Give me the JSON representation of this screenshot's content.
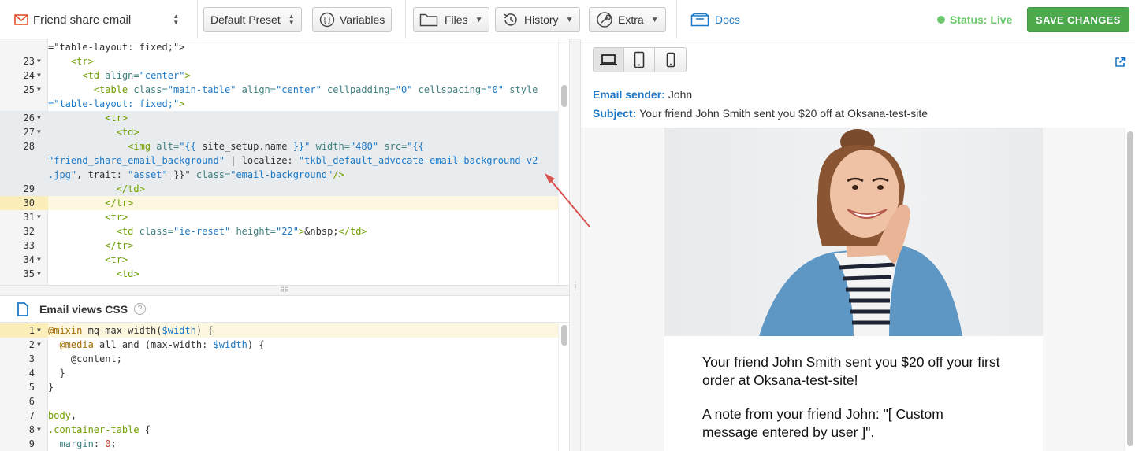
{
  "topbar": {
    "template_name": "Friend share email",
    "preset": "Default Preset",
    "variables": "Variables",
    "files": "Files",
    "history": "History",
    "extra": "Extra",
    "docs": "Docs",
    "status": "Status: Live",
    "save": "SAVE CHANGES"
  },
  "html_editor": {
    "lines": [
      {
        "num": "",
        "fold": false,
        "tokens": [
          [
            "p",
            "=\"table-layout: fixed;\">"
          ]
        ]
      },
      {
        "num": "23",
        "fold": true,
        "tokens": [
          [
            "p",
            "    "
          ],
          [
            "t",
            "<tr>"
          ]
        ]
      },
      {
        "num": "24",
        "fold": true,
        "tokens": [
          [
            "p",
            "      "
          ],
          [
            "t",
            "<td "
          ],
          [
            "a",
            "align="
          ],
          [
            "s",
            "\"center\""
          ],
          [
            "t",
            ">"
          ]
        ]
      },
      {
        "num": "25",
        "fold": true,
        "tokens": [
          [
            "p",
            "        "
          ],
          [
            "t",
            "<table "
          ],
          [
            "a",
            "class="
          ],
          [
            "s",
            "\"main-table\" "
          ],
          [
            "a",
            "align="
          ],
          [
            "s",
            "\"center\" "
          ],
          [
            "a",
            "cellpadding="
          ],
          [
            "s",
            "\"0\" "
          ],
          [
            "a",
            "cellspacing="
          ],
          [
            "s",
            "\"0\" "
          ],
          [
            "a",
            "style"
          ]
        ]
      },
      {
        "num": "",
        "fold": false,
        "tokens": [
          [
            "s",
            "=\"table-layout: fixed;\""
          ],
          [
            "t",
            ">"
          ]
        ]
      },
      {
        "num": "26",
        "fold": true,
        "hl": true,
        "tokens": [
          [
            "p",
            "          "
          ],
          [
            "t",
            "<tr>"
          ]
        ]
      },
      {
        "num": "27",
        "fold": true,
        "hl": true,
        "tokens": [
          [
            "p",
            "            "
          ],
          [
            "t",
            "<td>"
          ]
        ]
      },
      {
        "num": "28",
        "fold": false,
        "hl": true,
        "tokens": [
          [
            "p",
            "              "
          ],
          [
            "t",
            "<img "
          ],
          [
            "a",
            "alt="
          ],
          [
            "s",
            "\"{{ "
          ],
          [
            "p",
            "site_setup.name "
          ],
          [
            "s",
            "}}\" "
          ],
          [
            "a",
            "width="
          ],
          [
            "s",
            "\"480\" "
          ],
          [
            "a",
            "src="
          ],
          [
            "s",
            "\"{{"
          ]
        ]
      },
      {
        "num": "",
        "fold": false,
        "hl": true,
        "tokens": [
          [
            "s",
            "\"friend_share_email_background\" "
          ],
          [
            "p",
            "| localize: "
          ],
          [
            "s",
            "\"tkbl_default_advocate-email-background-v2"
          ]
        ]
      },
      {
        "num": "",
        "fold": false,
        "hl": true,
        "tokens": [
          [
            "s",
            ".jpg\""
          ],
          [
            "p",
            ", trait: "
          ],
          [
            "s",
            "\"asset\" "
          ],
          [
            "p",
            "}}\" "
          ],
          [
            "a",
            "class="
          ],
          [
            "s",
            "\"email-background\""
          ],
          [
            "t",
            "/>"
          ]
        ]
      },
      {
        "num": "29",
        "fold": false,
        "hl": true,
        "tokens": [
          [
            "p",
            "            "
          ],
          [
            "t",
            "</td>"
          ]
        ]
      },
      {
        "num": "30",
        "fold": false,
        "cur": true,
        "tokens": [
          [
            "p",
            "          "
          ],
          [
            "t",
            "</tr>"
          ]
        ]
      },
      {
        "num": "31",
        "fold": true,
        "tokens": [
          [
            "p",
            "          "
          ],
          [
            "t",
            "<tr>"
          ]
        ]
      },
      {
        "num": "32",
        "fold": false,
        "tokens": [
          [
            "p",
            "            "
          ],
          [
            "t",
            "<td "
          ],
          [
            "a",
            "class="
          ],
          [
            "s",
            "\"ie-reset\" "
          ],
          [
            "a",
            "height="
          ],
          [
            "s",
            "\"22\""
          ],
          [
            "t",
            ">"
          ],
          [
            "p",
            "&nbsp;"
          ],
          [
            "t",
            "</td>"
          ]
        ]
      },
      {
        "num": "33",
        "fold": false,
        "tokens": [
          [
            "p",
            "          "
          ],
          [
            "t",
            "</tr>"
          ]
        ]
      },
      {
        "num": "34",
        "fold": true,
        "tokens": [
          [
            "p",
            "          "
          ],
          [
            "t",
            "<tr>"
          ]
        ]
      },
      {
        "num": "35",
        "fold": true,
        "tokens": [
          [
            "p",
            "            "
          ],
          [
            "t",
            "<td>"
          ]
        ]
      }
    ]
  },
  "css_editor": {
    "title": "Email views CSS",
    "help": "?",
    "lines": [
      {
        "num": "1",
        "fold": true,
        "cur": true,
        "tokens": [
          [
            "k",
            "@mixin "
          ],
          [
            "p",
            "mq-max-width("
          ],
          [
            "v",
            "$width"
          ],
          [
            "p",
            ") {"
          ]
        ]
      },
      {
        "num": "2",
        "fold": true,
        "tokens": [
          [
            "p",
            "  "
          ],
          [
            "k",
            "@media "
          ],
          [
            "p",
            "all and (max-width: "
          ],
          [
            "v",
            "$width"
          ],
          [
            "p",
            ") {"
          ]
        ]
      },
      {
        "num": "3",
        "fold": false,
        "tokens": [
          [
            "p",
            "    @content;"
          ]
        ]
      },
      {
        "num": "4",
        "fold": false,
        "tokens": [
          [
            "p",
            "  }"
          ]
        ]
      },
      {
        "num": "5",
        "fold": false,
        "tokens": [
          [
            "p",
            "}"
          ]
        ]
      },
      {
        "num": "6",
        "fold": false,
        "tokens": [
          [
            "p",
            ""
          ]
        ]
      },
      {
        "num": "7",
        "fold": false,
        "tokens": [
          [
            "t",
            "body"
          ],
          [
            "p",
            ","
          ]
        ]
      },
      {
        "num": "8",
        "fold": true,
        "tokens": [
          [
            "t",
            ".container-table "
          ],
          [
            "p",
            "{"
          ]
        ]
      },
      {
        "num": "9",
        "fold": false,
        "tokens": [
          [
            "p",
            "  "
          ],
          [
            "a",
            "margin"
          ],
          [
            "p",
            ": "
          ],
          [
            "n",
            "0"
          ],
          [
            "p",
            ";"
          ]
        ]
      }
    ]
  },
  "preview": {
    "sender_label": "Email sender:",
    "sender": "John",
    "subject_label": "Subject:",
    "subject": "Your friend John Smith sent you $20 off at Oksana-test-site",
    "body_line1": "Your friend John Smith sent you $20 off your first order at Oksana-test-site!",
    "body_line2": "A note from your friend John: \"[ Custom message entered by user ]\"."
  },
  "colors": {
    "accent": "#1d79c7",
    "status_live": "#6dc96d",
    "save_button": "#4caa4c",
    "annotation_arrow": "#d9534f"
  }
}
